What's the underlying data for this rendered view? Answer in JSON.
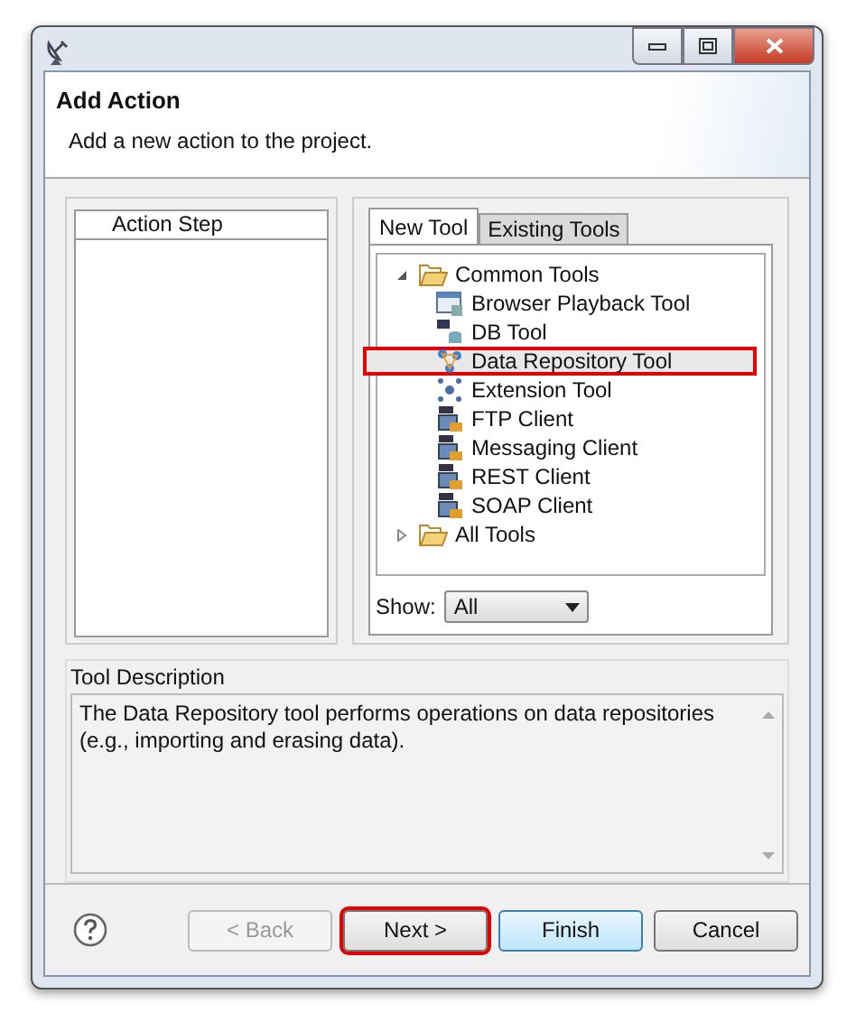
{
  "header": {
    "title": "Add Action",
    "subtitle": "Add a new action to the project."
  },
  "action_step": {
    "heading": "Action Step"
  },
  "tabs": [
    {
      "label": "New Tool",
      "selected": true
    },
    {
      "label": "Existing Tools",
      "selected": false
    }
  ],
  "tree": [
    {
      "label": "Common Tools",
      "expanded": true,
      "children": [
        {
          "label": "Browser Playback Tool",
          "kind": "browser",
          "selected": false,
          "highlighted": false
        },
        {
          "label": "DB Tool",
          "kind": "db",
          "selected": false,
          "highlighted": false
        },
        {
          "label": "Data Repository Tool",
          "kind": "repository",
          "selected": true,
          "highlighted": true
        },
        {
          "label": "Extension Tool",
          "kind": "extension",
          "selected": false,
          "highlighted": false
        },
        {
          "label": "FTP Client",
          "kind": "ftp",
          "selected": false,
          "highlighted": false
        },
        {
          "label": "Messaging Client",
          "kind": "messaging",
          "selected": false,
          "highlighted": false
        },
        {
          "label": "REST Client",
          "kind": "rest",
          "selected": false,
          "highlighted": false
        },
        {
          "label": "SOAP Client",
          "kind": "soap",
          "selected": false,
          "highlighted": false
        }
      ]
    },
    {
      "label": "All Tools",
      "expanded": false
    }
  ],
  "show": {
    "label": "Show:",
    "value": "All"
  },
  "description": {
    "heading": "Tool Description",
    "text": "The Data Repository tool performs operations on data repositories (e.g., importing and erasing data)."
  },
  "buttons": [
    {
      "label": "< Back",
      "kind": "normal",
      "disabled": true,
      "highlighted": false
    },
    {
      "label": "Next >",
      "kind": "normal",
      "disabled": false,
      "highlighted": true
    },
    {
      "label": "Finish",
      "kind": "default",
      "disabled": false,
      "highlighted": false
    },
    {
      "label": "Cancel",
      "kind": "normal",
      "disabled": false,
      "highlighted": false
    }
  ]
}
